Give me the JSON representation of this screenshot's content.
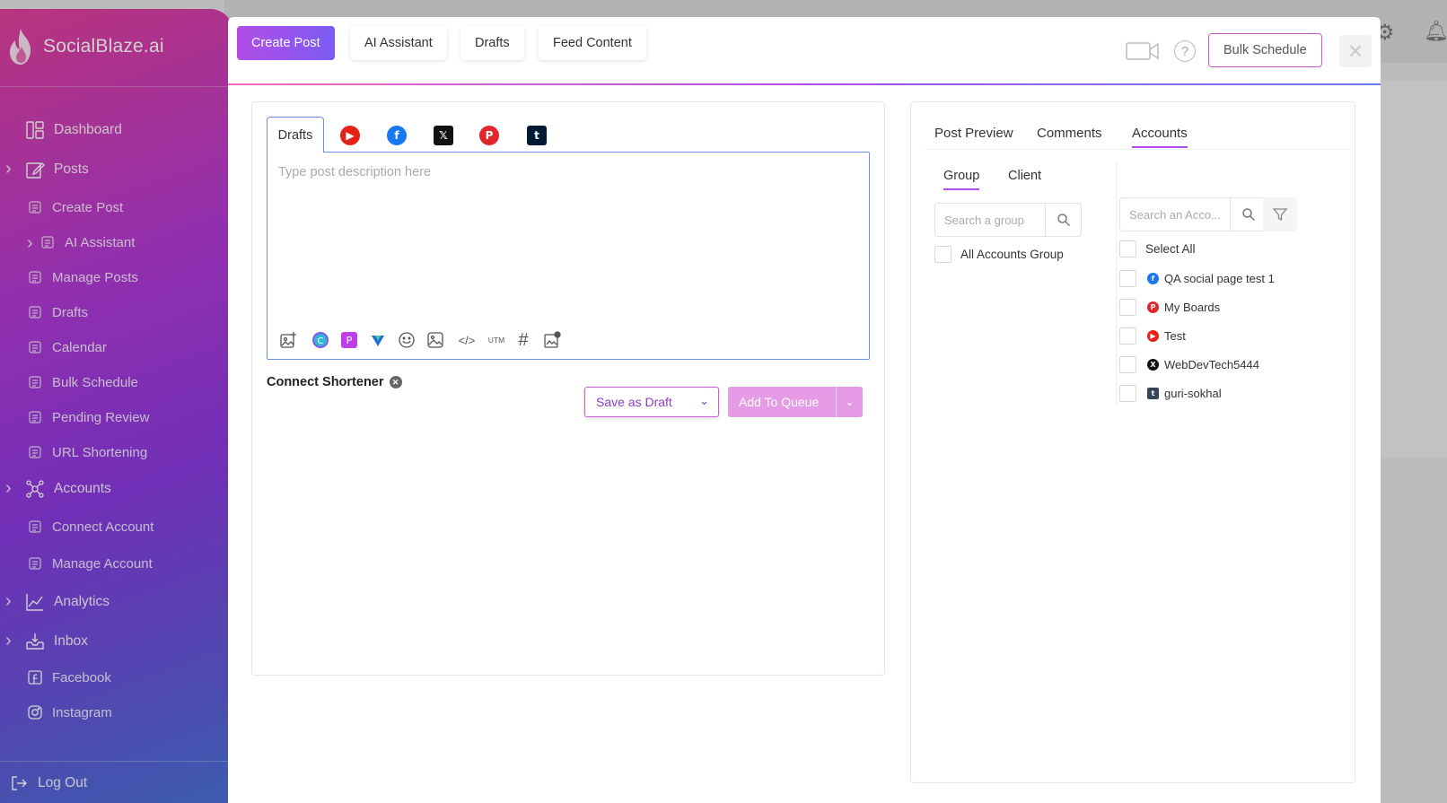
{
  "app": {
    "name": "SocialBlaze.ai"
  },
  "sidebar": {
    "items": [
      {
        "label": "Dashboard",
        "icon": "dashboard-icon",
        "expandable": false
      },
      {
        "label": "Posts",
        "icon": "edit-icon",
        "expandable": true
      },
      {
        "label": "Create Post",
        "icon": "create-post-icon",
        "sub": true
      },
      {
        "label": "AI Assistant",
        "icon": "ai-icon",
        "sub": true,
        "expandable": true
      },
      {
        "label": "Manage Posts",
        "icon": "manage-posts-icon",
        "sub": true
      },
      {
        "label": "Drafts",
        "icon": "drafts-icon",
        "sub": true
      },
      {
        "label": "Calendar",
        "icon": "calendar-icon",
        "sub": true
      },
      {
        "label": "Bulk Schedule",
        "icon": "calendar-icon",
        "sub": true
      },
      {
        "label": "Pending Review",
        "icon": "review-icon",
        "sub": true
      },
      {
        "label": "URL Shortening",
        "icon": "link-icon",
        "sub": true
      },
      {
        "label": "Accounts",
        "icon": "accounts-icon",
        "expandable": true
      },
      {
        "label": "Connect Account",
        "icon": "connect-icon",
        "sub": true
      },
      {
        "label": "Manage Account",
        "icon": "manage-account-icon",
        "sub": true
      },
      {
        "label": "Analytics",
        "icon": "analytics-icon",
        "expandable": true
      },
      {
        "label": "Inbox",
        "icon": "inbox-icon",
        "expandable": true
      },
      {
        "label": "Facebook",
        "icon": "facebook-icon",
        "sub": true
      },
      {
        "label": "Instagram",
        "icon": "instagram-icon",
        "sub": true
      }
    ],
    "logout": "Log Out"
  },
  "modal": {
    "tabs": [
      "Create Post",
      "AI Assistant",
      "Drafts",
      "Feed Content"
    ],
    "bulk_schedule": "Bulk Schedule",
    "help": "?",
    "close": "×"
  },
  "editor": {
    "active_tab": "Drafts",
    "placeholder": "Type post description here",
    "networks": [
      {
        "name": "youtube-icon",
        "color": "#e62117",
        "glyph": "▶"
      },
      {
        "name": "facebook-icon",
        "color": "#1877f2",
        "glyph": "f"
      },
      {
        "name": "x-icon",
        "color": "#111111",
        "glyph": "𝕏"
      },
      {
        "name": "pinterest-icon",
        "color": "#e0272c",
        "glyph": "P"
      },
      {
        "name": "tumblr-icon",
        "color": "#001935",
        "glyph": "t"
      }
    ],
    "toolbar_icons": [
      "add-image-icon",
      "canva-icon",
      "picsart-icon",
      "vista-icon",
      "emoji-icon",
      "gallery-icon",
      "code-icon",
      "utm-icon",
      "hashtag-icon",
      "media-library-icon"
    ],
    "utm_label": "UTM",
    "hashtag_glyph": "#",
    "code_glyph": "</>",
    "shortener_label": "Connect Shortener",
    "save_draft": "Save as Draft",
    "add_to_queue": "Add To Queue"
  },
  "right_panel": {
    "tabs": [
      "Post Preview",
      "Comments",
      "Accounts"
    ],
    "active_tab": "Accounts",
    "sub_tabs": [
      "Group",
      "Client"
    ],
    "group_search_placeholder": "Search a group",
    "account_search_placeholder": "Search an Acco...",
    "groups": [
      "All Accounts Group"
    ],
    "select_all": "Select All",
    "accounts": [
      {
        "name": "QA social page test 1",
        "network": "facebook",
        "color": "#1877f2",
        "glyph": "f"
      },
      {
        "name": "My Boards",
        "network": "pinterest",
        "color": "#e0272c",
        "glyph": "P"
      },
      {
        "name": "Test",
        "network": "youtube",
        "color": "#e62117",
        "glyph": "▶"
      },
      {
        "name": "WebDevTech5444",
        "network": "x",
        "color": "#111111",
        "glyph": "X"
      },
      {
        "name": "guri-sokhal",
        "network": "tumblr",
        "color": "#35465c",
        "glyph": "t"
      }
    ]
  },
  "colors": {
    "accent": "#b14de6",
    "brand_gradient_start": "#e1409a",
    "brand_gradient_end": "#4a72d8"
  }
}
